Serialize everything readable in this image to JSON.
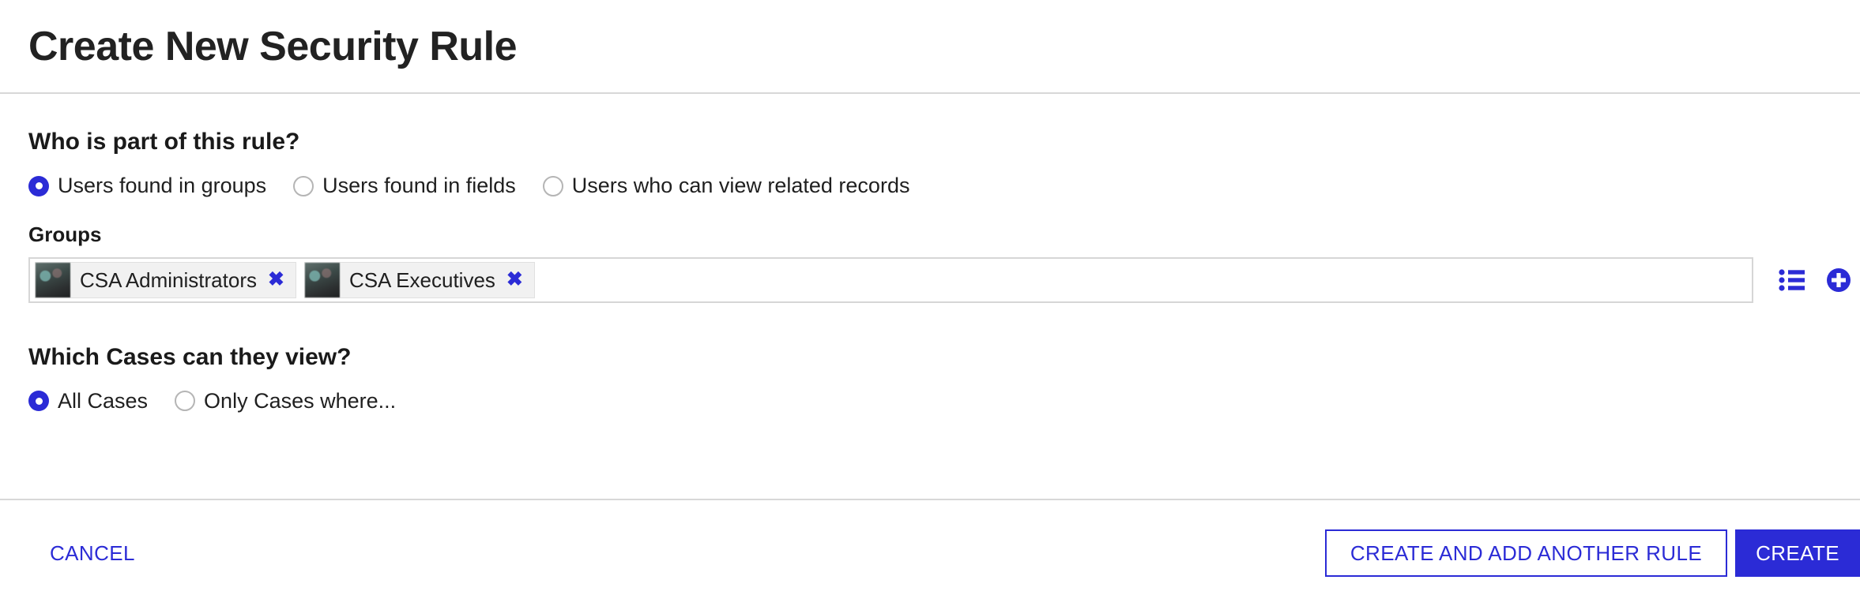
{
  "dialog": {
    "title": "Create New Security Rule"
  },
  "who_section": {
    "heading": "Who is part of this rule?",
    "options": [
      {
        "label": "Users found in groups",
        "selected": true
      },
      {
        "label": "Users found in fields",
        "selected": false
      },
      {
        "label": "Users who can view related records",
        "selected": false
      }
    ]
  },
  "groups_field": {
    "label": "Groups",
    "tokens": [
      {
        "name": "CSA Administrators",
        "remove_glyph": "✖"
      },
      {
        "name": "CSA Executives",
        "remove_glyph": "✖"
      }
    ],
    "actions": [
      {
        "icon": "list-icon"
      },
      {
        "icon": "add-circle-icon"
      }
    ]
  },
  "cases_section": {
    "heading": "Which Cases can they view?",
    "options": [
      {
        "label": "All Cases",
        "selected": true
      },
      {
        "label": "Only Cases where...",
        "selected": false
      }
    ]
  },
  "footer": {
    "cancel_label": "CANCEL",
    "create_and_add_label": "CREATE AND ADD ANOTHER RULE",
    "create_label": "CREATE"
  },
  "colors": {
    "accent": "#2b2bd6",
    "divider": "#d8d8d8",
    "field_border": "#d6d6d6",
    "token_bg": "#f1f1f1",
    "text": "#1a1a1a"
  }
}
